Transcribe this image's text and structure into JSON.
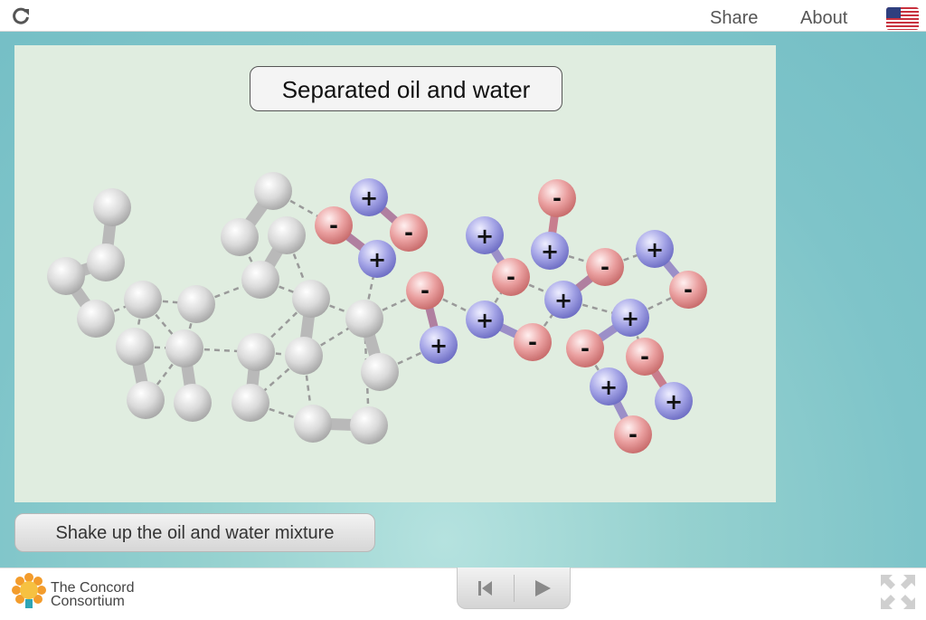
{
  "topbar": {
    "reload_icon": "reload-icon",
    "share_label": "Share",
    "about_label": "About",
    "language_icon": "us-flag-icon"
  },
  "model": {
    "title": "Separated oil and water",
    "oil_color": "#d0d0d0",
    "hydrogen_color": "#8e8ed8",
    "oxygen_color": "#e08a8a",
    "background_color": "#e0ede0"
  },
  "actions": {
    "shake_label": "Shake up the oil and water mixture"
  },
  "footer": {
    "logo_line1": "The Concord",
    "logo_line2": "Consortium",
    "reset_icon": "reset-icon",
    "play_icon": "play-icon",
    "fullscreen_icon": "fullscreen-icon"
  },
  "colors": {
    "stage": "#7ec4c9",
    "accent": "#f39c2c"
  }
}
